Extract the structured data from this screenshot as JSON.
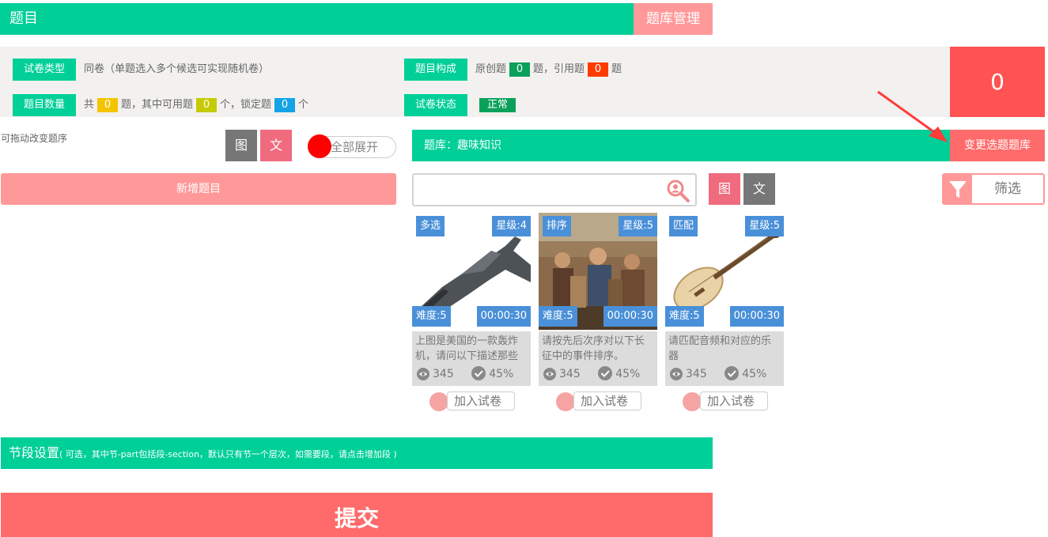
{
  "header": {
    "title": "题目",
    "bank_manage": "题库管理"
  },
  "info": {
    "paper_type_label": "试卷类型",
    "paper_type_value": "同卷（单题选入多个候选可实现随机卷）",
    "count_label": "题目数量",
    "count_prefix": "共",
    "count_total": "0",
    "count_mid": "题，其中可用题",
    "count_available": "0",
    "count_mid2": "个，锁定题",
    "count_locked": "0",
    "count_suffix": "个",
    "composition_label": "题目构成",
    "original_label": "原创题",
    "original_count": "0",
    "quote_label": "题，引用题",
    "quote_count": "0",
    "quote_suffix": "题",
    "status_label": "试卷状态",
    "status_value": "正常",
    "total_number": "0"
  },
  "left": {
    "drag_hint": "可拖动改变题序",
    "pic_btn": "图",
    "text_btn": "文",
    "expand_all": "全部展开",
    "add_question": "新增题目"
  },
  "bank": {
    "title": "题库：趣味知识",
    "change_bank": "变更选题题库",
    "search_placeholder": "",
    "pic_btn": "图",
    "text_btn": "文",
    "filter": "筛选"
  },
  "cards": [
    {
      "type": "多选",
      "stars": "星级:4",
      "difficulty": "难度:5",
      "time": "00:00:30",
      "desc": "上图是美国的一款轰炸机，请问以下描述那些",
      "views": "345",
      "rate": "45%",
      "add": "加入试卷"
    },
    {
      "type": "排序",
      "stars": "星级:5",
      "difficulty": "难度:5",
      "time": "00:00:30",
      "desc": "请按先后次序对以下长征中的事件排序。",
      "views": "345",
      "rate": "45%",
      "add": "加入试卷"
    },
    {
      "type": "匹配",
      "stars": "星级:5",
      "difficulty": "难度:5",
      "time": "00:00:30",
      "desc": "请匹配音频和对应的乐器",
      "views": "345",
      "rate": "45%",
      "add": "加入试卷"
    }
  ],
  "section": {
    "title": "节段设置",
    "subtitle": "( 可选，其中节-part包括段-section，默认只有节一个层次，如需要段，请点击增加段 )"
  },
  "submit": "提交",
  "colors": {
    "accent": "#00cf98",
    "pink": "#ff9999",
    "red": "#ff5252",
    "badge": "#4a90d9"
  }
}
